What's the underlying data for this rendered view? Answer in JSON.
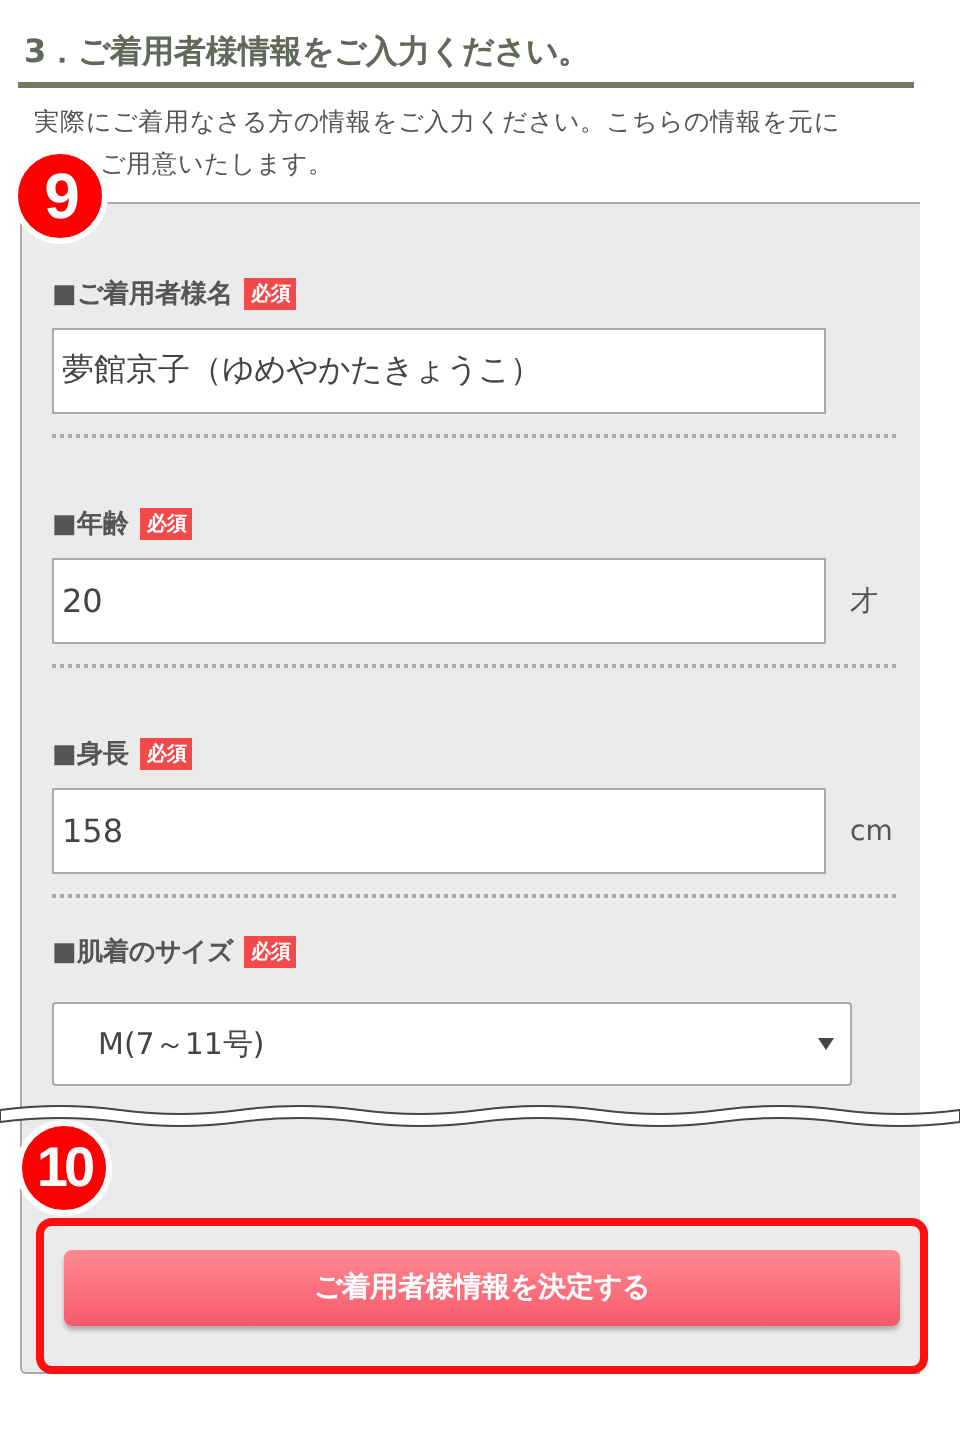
{
  "heading": "3．ご着用者様情報をご入力ください。",
  "intro": {
    "line_1": "実際にご着用なさる方の情報をご入力ください。こちらの情報を元に",
    "line_2": "ご用意いたします。"
  },
  "step_badges": [
    "9",
    "10"
  ],
  "fields": [
    {
      "kind": "text",
      "label": "■ご着用者様名",
      "required_badge": "必須",
      "value": "夢館京子（ゆめやかたきょうこ）"
    },
    {
      "kind": "text",
      "label": "■年齢",
      "required_badge": "必須",
      "value": "20",
      "unit": "才"
    },
    {
      "kind": "text",
      "label": "■身長",
      "required_badge": "必須",
      "value": "158",
      "unit": "cm"
    },
    {
      "kind": "select",
      "label": "■肌着のサイズ",
      "required_badge": "必須",
      "value": "M(7～11号)"
    }
  ],
  "submit_button": "ご着用者様情報を決定する"
}
